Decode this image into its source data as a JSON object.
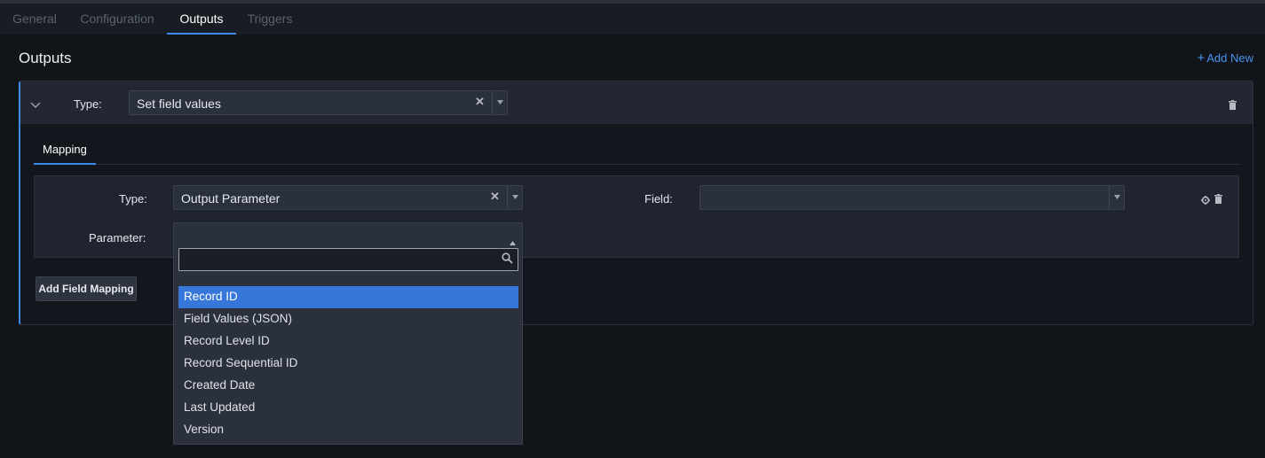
{
  "tabs": [
    {
      "label": "General",
      "active": false
    },
    {
      "label": "Configuration",
      "active": false
    },
    {
      "label": "Outputs",
      "active": true
    },
    {
      "label": "Triggers",
      "active": false
    }
  ],
  "section": {
    "title": "Outputs",
    "add_new_label": "Add New"
  },
  "output_card": {
    "type_label": "Type:",
    "type_value": "Set field values",
    "subtabs": [
      {
        "label": "Mapping",
        "active": true
      }
    ],
    "mapping": {
      "type_label": "Type:",
      "type_value": "Output Parameter",
      "field_label": "Field:",
      "field_value": "",
      "parameter_label": "Parameter:"
    },
    "add_mapping_label": "Add Field Mapping"
  },
  "parameter_dropdown": {
    "search_value": "",
    "options": [
      {
        "label": "Record ID",
        "selected": true
      },
      {
        "label": "Field Values (JSON)",
        "selected": false
      },
      {
        "label": "Record Level ID",
        "selected": false
      },
      {
        "label": "Record Sequential ID",
        "selected": false
      },
      {
        "label": "Created Date",
        "selected": false
      },
      {
        "label": "Last Updated",
        "selected": false
      },
      {
        "label": "Version",
        "selected": false
      }
    ]
  },
  "colors": {
    "accent": "#3d8be8",
    "background": "#111419",
    "selected_option": "#3677d9"
  },
  "icons": {
    "add": "plus-icon",
    "collapse": "chevron-down-icon",
    "delete": "trash-icon",
    "settings": "gear-icon",
    "search": "search-icon",
    "clear": "clear-x-icon",
    "dropdown": "caret-down-icon"
  }
}
